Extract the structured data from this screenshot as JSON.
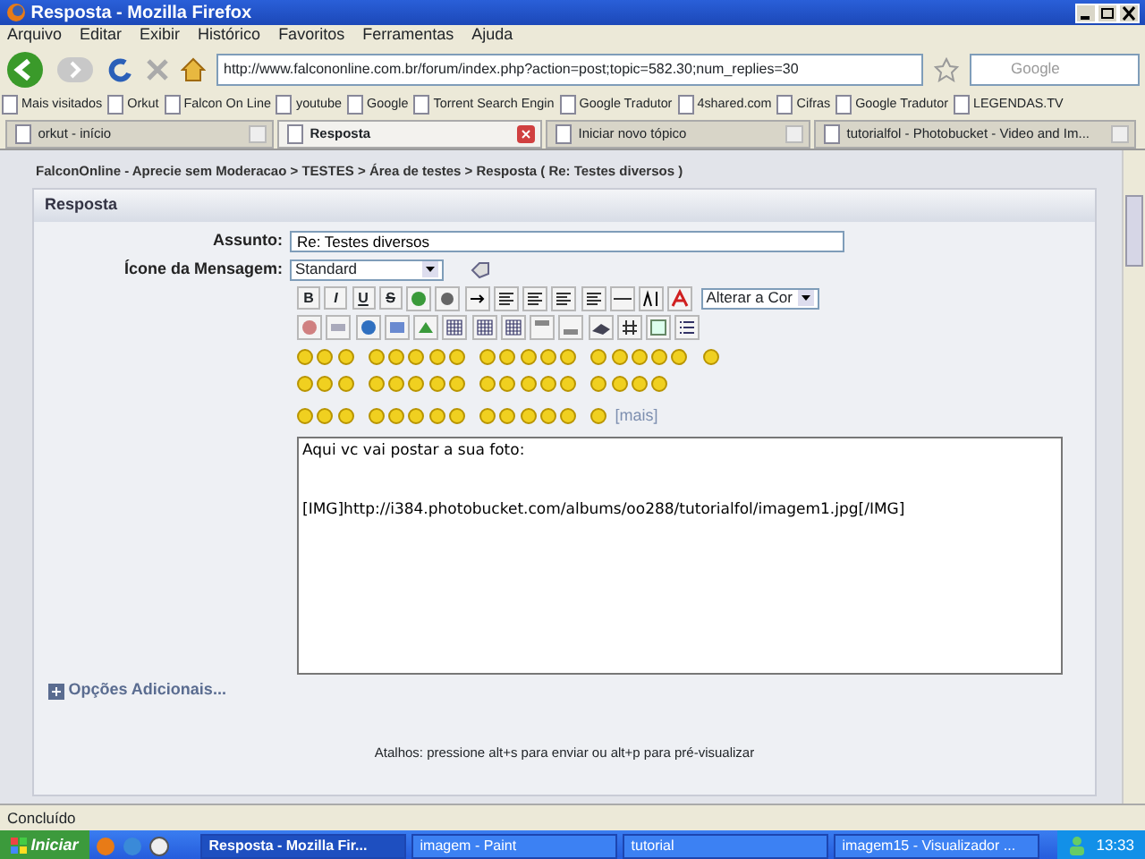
{
  "window": {
    "title": "Resposta - Mozilla Firefox"
  },
  "menu": [
    "Arquivo",
    "Editar",
    "Exibir",
    "Histórico",
    "Favoritos",
    "Ferramentas",
    "Ajuda"
  ],
  "address_bar": {
    "value": "http://www.falcononline.com.br/forum/index.php?action=post;topic=582.30;num_replies=30"
  },
  "search": {
    "placeholder": "Google"
  },
  "bookmarks": [
    "Mais visitados",
    "Orkut",
    "Falcon On Line",
    "youtube",
    "Google",
    "Torrent Search Engin",
    "Google Tradutor",
    "4shared.com",
    "Cifras",
    "Google Tradutor",
    "LEGENDAS.TV"
  ],
  "tabs": [
    {
      "label": "orkut - início",
      "selected": false
    },
    {
      "label": "Resposta",
      "selected": true
    },
    {
      "label": "Iniciar novo tópico",
      "selected": false
    },
    {
      "label": "tutorialfol - Photobucket - Video and Im...",
      "selected": false
    }
  ],
  "breadcrumb": "FalconOnline - Aprecie sem Moderacao > TESTES > Área de testes > Resposta ( Re: Testes diversos )",
  "panel": {
    "title": "Resposta"
  },
  "subject": {
    "label": "Assunto:",
    "value": "Re: Testes diversos"
  },
  "message_icon": {
    "label": "Ícone da Mensagem:",
    "value": "Standard"
  },
  "format_buttons": [
    {
      "label": "B",
      "kind": "bold"
    },
    {
      "label": "I",
      "kind": "italic"
    },
    {
      "label": "U",
      "kind": "underline"
    },
    {
      "label": "S",
      "kind": "strike"
    }
  ],
  "color_select": {
    "value": "Alterar a Cor"
  },
  "more_smileys": "[mais]",
  "message": {
    "value": "Aqui vc vai postar a sua foto:\n\n\n[IMG]http://i384.photobucket.com/albums/oo288/tutorialfol/imagem1.jpg[/IMG]"
  },
  "additional_options": "Opções Adicionais...",
  "shortcuts": "Atalhos: pressione alt+s para enviar ou alt+p para pré-visualizar",
  "status_bar": {
    "text": "Concluído"
  },
  "taskbar": {
    "start": "Iniciar",
    "tasks": [
      {
        "label": "Resposta - Mozilla Fir...",
        "selected": true
      },
      {
        "label": "imagem - Paint",
        "selected": false
      },
      {
        "label": "tutorial",
        "selected": false
      },
      {
        "label": "imagem15 - Visualizador ...",
        "selected": false
      }
    ],
    "clock": "13:33"
  }
}
